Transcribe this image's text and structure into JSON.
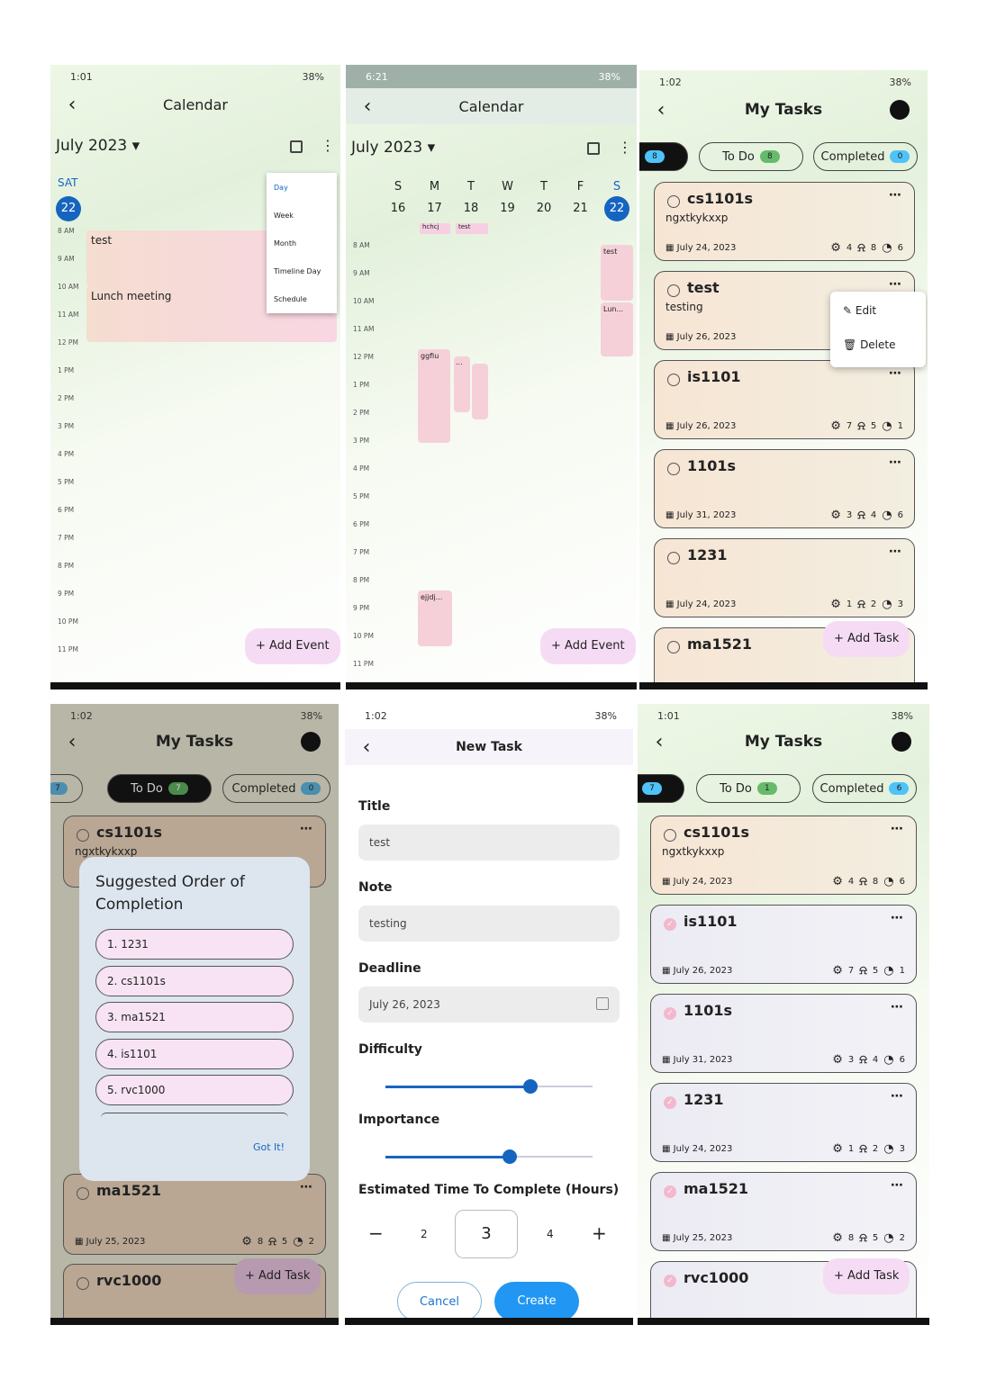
{
  "status": {
    "s1": {
      "time": "1:01",
      "right": "38%"
    },
    "s2": {
      "time": "6:21",
      "right": "38%"
    },
    "s3": {
      "time": "1:02",
      "right": "38%"
    },
    "s4": {
      "time": "1:02",
      "right": "38%"
    },
    "s5": {
      "time": "1:02",
      "right": "38%"
    },
    "s6": {
      "time": "1:01",
      "right": "38%"
    }
  },
  "calendar": {
    "title": "Calendar",
    "month": "July 2023 ▾",
    "add_event": "+ Add Event"
  },
  "cal_day": {
    "dow": "SAT",
    "day": "22",
    "menu": [
      "Day",
      "Week",
      "Month",
      "Timeline Day",
      "Schedule"
    ],
    "events": [
      "test",
      "Lunch meeting"
    ],
    "times": [
      "8 AM",
      "9 AM",
      "10 AM",
      "11 AM",
      "12 PM",
      "1 PM",
      "2 PM",
      "3 PM",
      "4 PM",
      "5 PM",
      "6 PM",
      "7 PM",
      "8 PM",
      "9 PM",
      "10 PM",
      "11 PM"
    ]
  },
  "cal_week": {
    "days": [
      {
        "l": "S",
        "n": "16"
      },
      {
        "l": "M",
        "n": "17"
      },
      {
        "l": "T",
        "n": "18"
      },
      {
        "l": "W",
        "n": "19"
      },
      {
        "l": "T",
        "n": "20"
      },
      {
        "l": "F",
        "n": "21"
      },
      {
        "l": "S",
        "n": "22"
      }
    ],
    "chips": [
      "hchcj",
      "test"
    ],
    "events": [
      "test",
      "Lun...",
      "ggfiu",
      "...",
      "ejjdj..."
    ]
  },
  "tasks": {
    "title": "My Tasks",
    "tab_all_badge_s3": "8",
    "tab_todo": "To Do",
    "tab_todo_badge_s3": "8",
    "tab_completed": "Completed",
    "tab_completed_badge_s3": "0",
    "tab_all_badge_s4": "7",
    "tab_todo_badge_s4": "7",
    "tab_completed_badge_s4": "0",
    "tab_all_badge_s6": "7",
    "tab_todo_badge_s6": "1",
    "tab_completed_badge_s6": "6",
    "add_task": "+ Add Task",
    "menu_edit": "Edit",
    "menu_delete": "Delete"
  },
  "task_list_s3": [
    {
      "name": "cs1101s",
      "note": "ngxtkykxxp",
      "date": "July 24, 2023",
      "d": "4",
      "i": "8",
      "h": "6"
    },
    {
      "name": "test",
      "note": "testing",
      "date": "July 26, 2023",
      "d": "",
      "i": "",
      "h": ""
    },
    {
      "name": "is1101",
      "note": "",
      "date": "July 26, 2023",
      "d": "7",
      "i": "5",
      "h": "1"
    },
    {
      "name": "1101s",
      "note": "",
      "date": "July 31, 2023",
      "d": "3",
      "i": "4",
      "h": "6"
    },
    {
      "name": "1231",
      "note": "",
      "date": "July 24, 2023",
      "d": "1",
      "i": "2",
      "h": "3"
    },
    {
      "name": "ma1521",
      "note": "",
      "date": "",
      "d": "",
      "i": "",
      "h": ""
    }
  ],
  "task_list_s6": [
    {
      "name": "cs1101s",
      "note": "ngxtkykxxp",
      "date": "July 24, 2023",
      "d": "4",
      "i": "8",
      "h": "6"
    },
    {
      "name": "is1101",
      "note": "",
      "date": "July 26, 2023",
      "d": "7",
      "i": "5",
      "h": "1"
    },
    {
      "name": "1101s",
      "note": "",
      "date": "July 31, 2023",
      "d": "3",
      "i": "4",
      "h": "6"
    },
    {
      "name": "1231",
      "note": "",
      "date": "July 24, 2023",
      "d": "1",
      "i": "2",
      "h": "3"
    },
    {
      "name": "ma1521",
      "note": "",
      "date": "July 25, 2023",
      "d": "8",
      "i": "5",
      "h": "2"
    },
    {
      "name": "rvc1000",
      "note": "",
      "date": "",
      "d": "",
      "i": "",
      "h": ""
    }
  ],
  "s4": {
    "bg_card1_name": "cs1101s",
    "bg_card1_note": "ngxtkykxxp",
    "ma_name": "ma1521",
    "ma_date": "July 25, 2023",
    "ma_d": "8",
    "ma_i": "5",
    "ma_h": "2",
    "rvc_name": "rvc1000",
    "dialog_title": "Suggested Order of Completion",
    "order": [
      "1.  1231",
      "2.  cs1101s",
      "3.  ma1521",
      "4.  is1101",
      "5.  rvc1000"
    ],
    "got_it": "Got It!"
  },
  "new_task": {
    "title": "New Task",
    "title_label": "Title",
    "title_value": "test",
    "note_label": "Note",
    "note_value": "testing",
    "deadline_label": "Deadline",
    "deadline_value": "July 26, 2023",
    "difficulty_label": "Difficulty",
    "difficulty_level": 0.7,
    "importance_label": "Importance",
    "importance_level": 0.6,
    "est_label": "Estimated Time To Complete (Hours)",
    "est_minus": "−",
    "est_prev": "2",
    "est_value": "3",
    "est_next": "4",
    "est_plus": "+",
    "cancel": "Cancel",
    "create": "Create"
  },
  "colors": {
    "accent": "#1565c0",
    "badge_blue": "#4fc3f7",
    "badge_green": "#66bb6a",
    "fab": "#f5dcf4"
  }
}
